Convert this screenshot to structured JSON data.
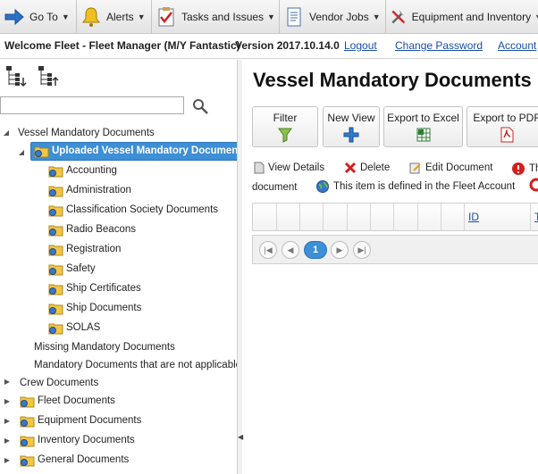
{
  "menubar": {
    "items": [
      {
        "label": "Go To",
        "icon": "arrow-right-icon"
      },
      {
        "label": "Alerts",
        "icon": "bell-icon"
      },
      {
        "label": "Tasks and Issues",
        "icon": "checklist-icon"
      },
      {
        "label": "Vendor Jobs",
        "icon": "document-icon"
      },
      {
        "label": "Equipment and Inventory",
        "icon": "tools-icon"
      }
    ]
  },
  "header": {
    "welcome": "Welcome Fleet - Fleet Manager (M/Y Fantastic)",
    "version": "Version 2017.10.14.0",
    "logout": "Logout",
    "change_password": "Change Password",
    "account": "Account"
  },
  "tree": {
    "search_placeholder": "",
    "root": "Vessel Mandatory Documents",
    "selected": "Uploaded Vessel Mandatory Documents",
    "children": [
      "Accounting",
      "Administration",
      "Classification Society Documents",
      "Radio Beacons",
      "Registration",
      "Safety",
      "Ship Certificates",
      "Ship Documents",
      "SOLAS"
    ],
    "siblings": [
      "Missing Mandatory Documents",
      "Mandatory Documents that are not applicable"
    ],
    "others": [
      {
        "label": "Crew Documents",
        "folder": false
      },
      {
        "label": "Fleet Documents",
        "folder": true
      },
      {
        "label": "Equipment Documents",
        "folder": true
      },
      {
        "label": "Inventory Documents",
        "folder": true
      },
      {
        "label": "General Documents",
        "folder": true
      }
    ]
  },
  "main": {
    "title": "Vessel Mandatory Documents",
    "toolbar": {
      "filter": "Filter",
      "new_view": "New View",
      "export_excel": "Export to Excel",
      "export_pdf": "Export to PDF"
    },
    "legend": {
      "view_details": "View Details",
      "delete": "Delete",
      "edit_document": "Edit Document",
      "th": "Th",
      "document": "document",
      "fleet_account": "This item is defined in the Fleet Account"
    },
    "grid": {
      "col_id": "ID",
      "col_t": "T"
    },
    "pager": {
      "current": "1"
    }
  },
  "colors": {
    "accent": "#3d8fd6",
    "link": "#1a4fa8",
    "header_bg": "#e9e9e9"
  }
}
